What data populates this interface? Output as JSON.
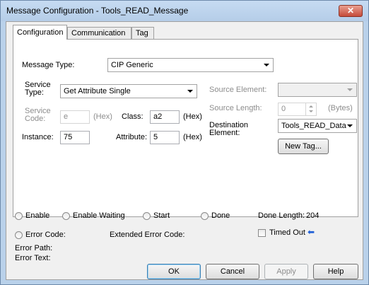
{
  "window": {
    "title": "Message Configuration - Tools_READ_Message",
    "close_glyph": "✕"
  },
  "tabs": [
    {
      "label": "Configuration",
      "active": true
    },
    {
      "label": "Communication",
      "active": false
    },
    {
      "label": "Tag",
      "active": false
    }
  ],
  "config": {
    "message_type_label": "Message Type:",
    "message_type_value": "CIP Generic",
    "service_type_label": "Service\nType:",
    "service_type_value": "Get Attribute Single",
    "service_code_label": "Service\nCode:",
    "service_code_value": "e",
    "service_code_unit": "(Hex)",
    "class_label": "Class:",
    "class_value": "a2",
    "class_unit": "(Hex)",
    "instance_label": "Instance:",
    "instance_value": "75",
    "attribute_label": "Attribute:",
    "attribute_value": "5",
    "attribute_unit": "(Hex)",
    "source_element_label": "Source Element:",
    "source_element_value": "",
    "source_length_label": "Source Length:",
    "source_length_value": "0",
    "source_length_unit": "(Bytes)",
    "destination_label": "Destination\nElement:",
    "destination_value": "Tools_READ_Data",
    "new_tag_label": "New Tag..."
  },
  "status": {
    "enable": "Enable",
    "enable_waiting": "Enable Waiting",
    "start": "Start",
    "done": "Done",
    "done_length_label": "Done Length:",
    "done_length_value": "204",
    "error_code": "Error Code:",
    "extended_error_code": "Extended Error Code:",
    "timed_out": "Timed Out",
    "error_path": "Error Path:",
    "error_text": "Error Text:"
  },
  "buttons": {
    "ok": "OK",
    "cancel": "Cancel",
    "apply": "Apply",
    "help": "Help"
  }
}
